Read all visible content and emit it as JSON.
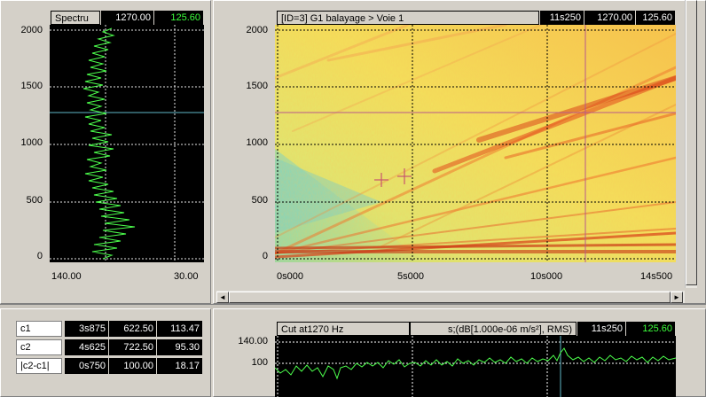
{
  "spectrum_panel": {
    "title": "Spectru",
    "value1": "1270.00",
    "value2": "125.60",
    "y_ticks": [
      "2000",
      "1500",
      "1000",
      "500",
      "0"
    ],
    "x_ticks": [
      "140.00",
      "30.00"
    ]
  },
  "spectrogram_panel": {
    "title": "[ID=3] G1 balayage > Voie 1",
    "time": "11s250",
    "freq": "1270.00",
    "level": "125.60",
    "y_ticks": [
      "2000",
      "1500",
      "1000",
      "500",
      "0"
    ],
    "x_ticks": [
      "0s000",
      "5s000",
      "10s000",
      "14s500"
    ],
    "scroll_left_arrow": "◄",
    "scroll_right_arrow": "►"
  },
  "cursor_table": {
    "rows": [
      {
        "name": "c1",
        "time": "3s875",
        "freq": "622.50",
        "level": "113.47"
      },
      {
        "name": "c2",
        "time": "4s625",
        "freq": "722.50",
        "level": "95.30"
      },
      {
        "name": "|c2-c1|",
        "time": "0s750",
        "freq": "100.00",
        "level": "18.17"
      }
    ]
  },
  "cut_panel": {
    "title": "Cut at1270 Hz",
    "unit": "s;(dB[1.000e-06 m/s²], RMS)",
    "time": "11s250",
    "level": "125.60",
    "y_ticks": [
      "140.00",
      "100"
    ]
  }
}
